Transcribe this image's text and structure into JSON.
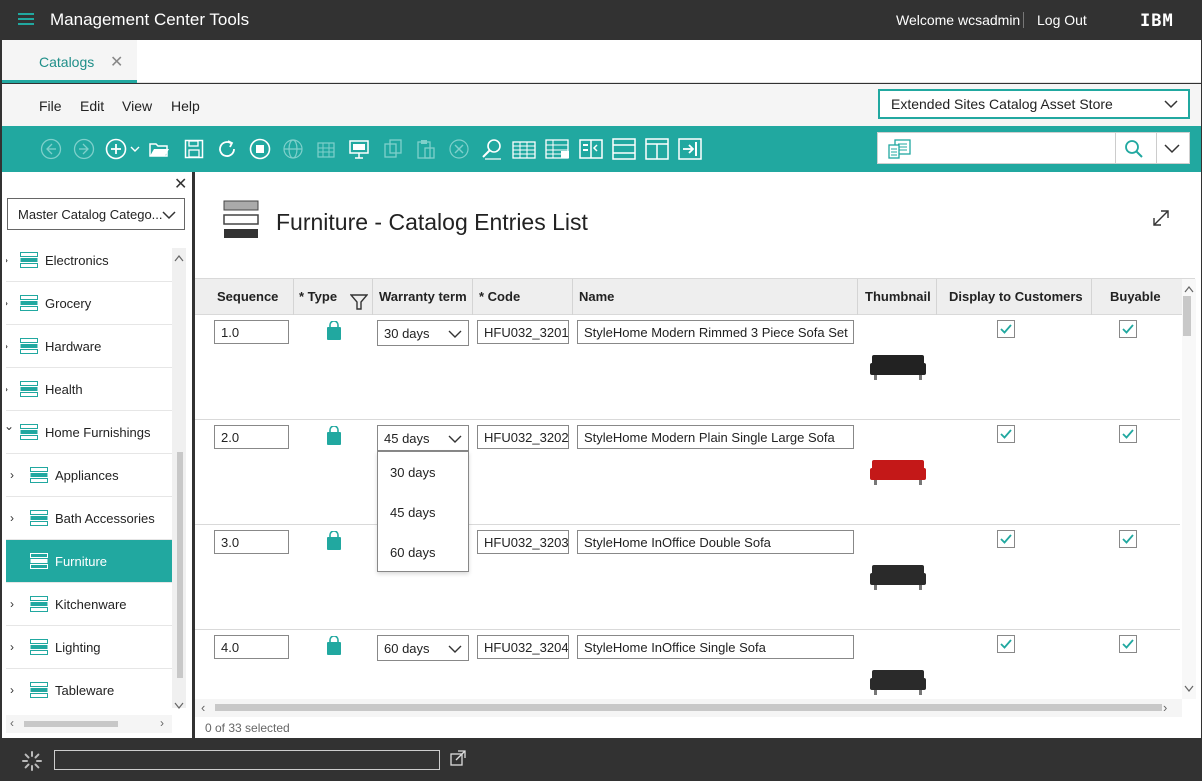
{
  "app": {
    "title": "Management Center Tools",
    "welcome": "Welcome wcsadmin",
    "logout": "Log Out",
    "brand": "IBM"
  },
  "tabs": [
    {
      "label": "Catalogs"
    }
  ],
  "menu": [
    "File",
    "Edit",
    "View",
    "Help"
  ],
  "store_select": {
    "value": "Extended Sites Catalog Asset Store"
  },
  "toolbar_icons": [
    "back-icon",
    "forward-icon",
    "new-icon",
    "open-folder-icon",
    "save-icon",
    "refresh-icon",
    "stop-icon",
    "globe-icon",
    "columns-icon",
    "presentation-icon",
    "copy-icon",
    "paste-icon",
    "delete-icon",
    "find-icon",
    "grid-icon",
    "grid-add-icon",
    "compare-icon",
    "split-horizontal-icon",
    "split-vertical-icon",
    "export-icon"
  ],
  "colors": {
    "accent": "#21a8a0",
    "dark": "#323232"
  },
  "left_panel": {
    "select_value": "Master Catalog Catego...",
    "tree": [
      {
        "label": "Electronics",
        "level": 0
      },
      {
        "label": "Grocery",
        "level": 0
      },
      {
        "label": "Hardware",
        "level": 0
      },
      {
        "label": "Health",
        "level": 0
      },
      {
        "label": "Home Furnishings",
        "level": 0,
        "expanded": true
      },
      {
        "label": "Appliances",
        "level": 1
      },
      {
        "label": "Bath Accessories",
        "level": 1
      },
      {
        "label": "Furniture",
        "level": 1,
        "selected": true
      },
      {
        "label": "Kitchenware",
        "level": 1
      },
      {
        "label": "Lighting",
        "level": 1
      },
      {
        "label": "Tableware",
        "level": 1
      }
    ]
  },
  "main": {
    "title": "Furniture - Catalog Entries List",
    "columns": [
      "Sequence",
      "* Type",
      "Warranty term",
      "* Code",
      "Name",
      "Thumbnail",
      "Display to Customers",
      "Buyable"
    ],
    "rows": [
      {
        "sequence": "1.0",
        "warranty": "30 days",
        "code": "HFU032_3201",
        "name": "StyleHome Modern Rimmed 3 Piece Sofa Set",
        "display": true,
        "buyable": true,
        "thumb_color": "#222222"
      },
      {
        "sequence": "2.0",
        "warranty": "45 days",
        "code": "HFU032_3202",
        "name": "StyleHome Modern Plain Single Large Sofa",
        "display": true,
        "buyable": true,
        "thumb_color": "#c41818"
      },
      {
        "sequence": "3.0",
        "warranty": "",
        "code": "HFU032_3203",
        "name": "StyleHome InOffice Double Sofa",
        "display": true,
        "buyable": true,
        "thumb_color": "#2a2a2a"
      },
      {
        "sequence": "4.0",
        "warranty": "60 days",
        "code": "HFU032_3204",
        "name": "StyleHome InOffice Single Sofa",
        "display": true,
        "buyable": true,
        "thumb_color": "#2a2a2a"
      }
    ],
    "warranty_options": [
      "30 days",
      "45 days",
      "60 days"
    ],
    "selected_count": "0 of 33 selected"
  }
}
